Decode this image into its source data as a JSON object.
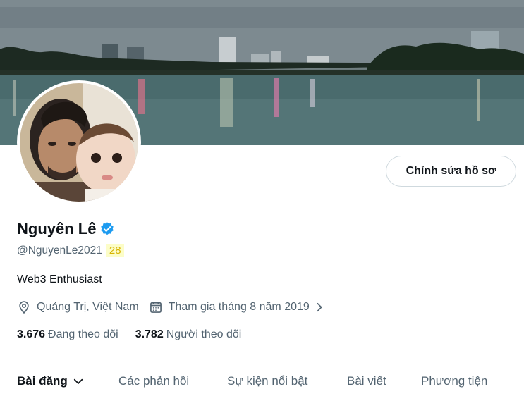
{
  "profile": {
    "name": "Nguyên Lê",
    "handle": "@NguyenLe2021",
    "badge_number": "28",
    "bio": "Web3 Enthusiast",
    "location": "Quảng Trị, Việt Nam",
    "joined": "Tham gia tháng 8 năm 2019",
    "following_count": "3.676",
    "following_label": "Đang theo dõi",
    "followers_count": "3.782",
    "followers_label": "Người theo dõi"
  },
  "actions": {
    "edit_profile_label": "Chỉnh sửa hồ sơ"
  },
  "tabs": [
    {
      "label": "Bài đăng",
      "active": true
    },
    {
      "label": "Các phản hồi",
      "active": false
    },
    {
      "label": "Sự kiện nổi bật",
      "active": false
    },
    {
      "label": "Bài viết",
      "active": false
    },
    {
      "label": "Phương tiện",
      "active": false
    }
  ],
  "icons": {
    "verified": "verified-badge-icon",
    "location": "location-pin-icon",
    "calendar": "calendar-icon",
    "tab_dropdown": "chevron-down-icon",
    "joined_more": "chevron-right-icon"
  },
  "colors": {
    "verified_blue": "#1d9bf0",
    "secondary_text": "#536471",
    "badge_background": "#fcfdc8",
    "badge_text": "#d8b400"
  }
}
